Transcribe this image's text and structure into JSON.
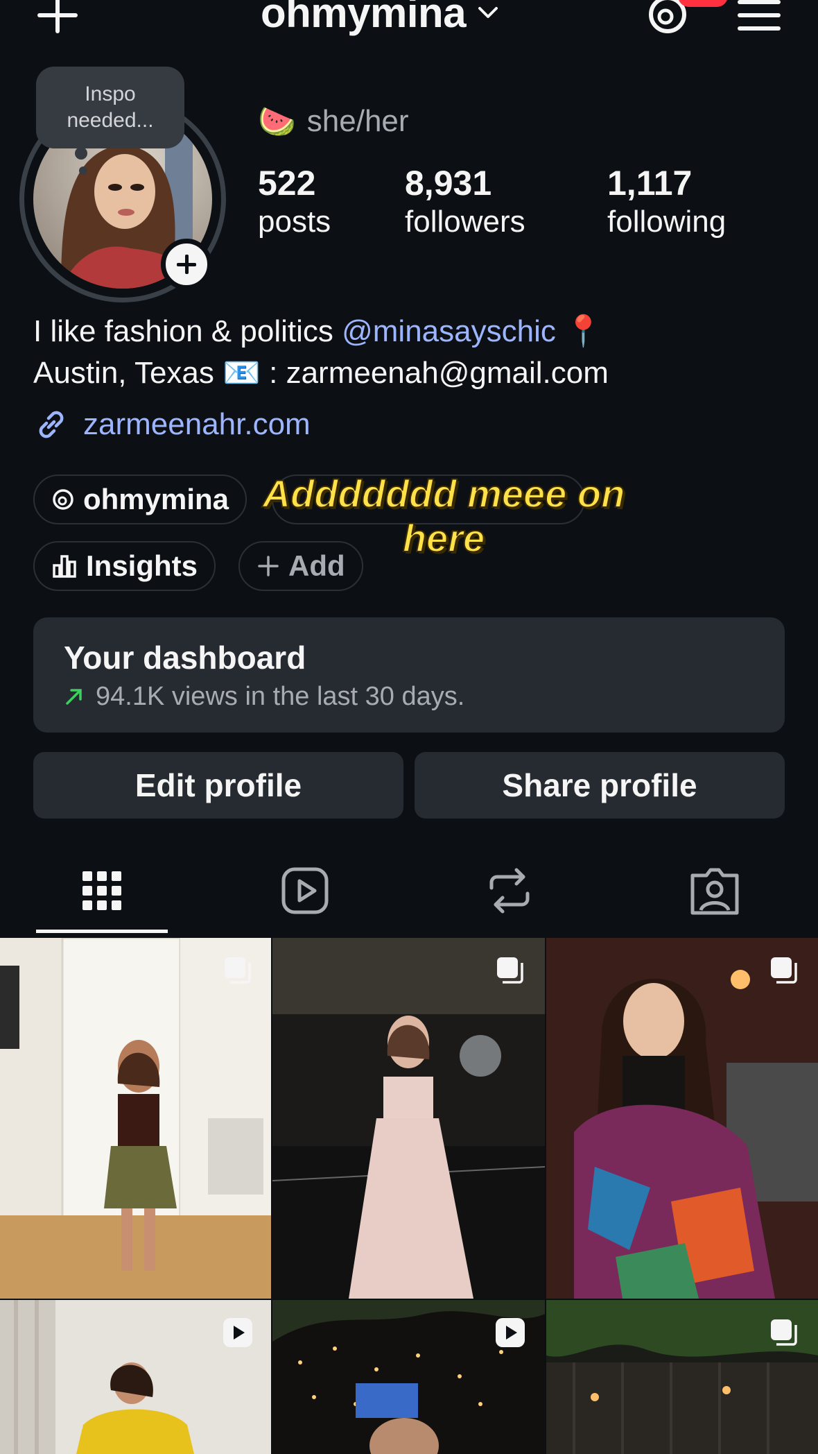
{
  "header": {
    "username": "ohmymina",
    "create_icon": "plus-icon",
    "threads_icon": "threads-icon",
    "menu_icon": "hamburger-menu-icon"
  },
  "profile": {
    "note": "Inspo needed...",
    "pronoun_emoji": "🍉",
    "pronouns": "she/her",
    "stats": [
      {
        "value": "522",
        "label": "posts"
      },
      {
        "value": "8,931",
        "label": "followers"
      },
      {
        "value": "1,117",
        "label": "following"
      }
    ]
  },
  "bio": {
    "line1_text": "I like fashion & politics ",
    "mention": "@minasayschic",
    "line1_end": " 📍",
    "line2": "Austin, Texas 📧 : zarmeenah@gmail.com",
    "link": "zarmeenahr.com"
  },
  "pills": {
    "threads": "ohmymina",
    "insights": "Insights",
    "add": "Add"
  },
  "overlay_caption": "Addddddd meee on here",
  "dashboard": {
    "title": "Your dashboard",
    "subtitle": "94.1K views in the last 30 days.",
    "accent_color": "#3ecf5e"
  },
  "actions": {
    "edit": "Edit profile",
    "share": "Share profile"
  },
  "tabs": [
    "posts-grid-icon",
    "reels-icon",
    "reposts-icon",
    "tagged-icon"
  ],
  "colors": {
    "background": "#0c1014",
    "card": "#262a31",
    "link": "#9db5ff",
    "notification": "#ff3040"
  }
}
